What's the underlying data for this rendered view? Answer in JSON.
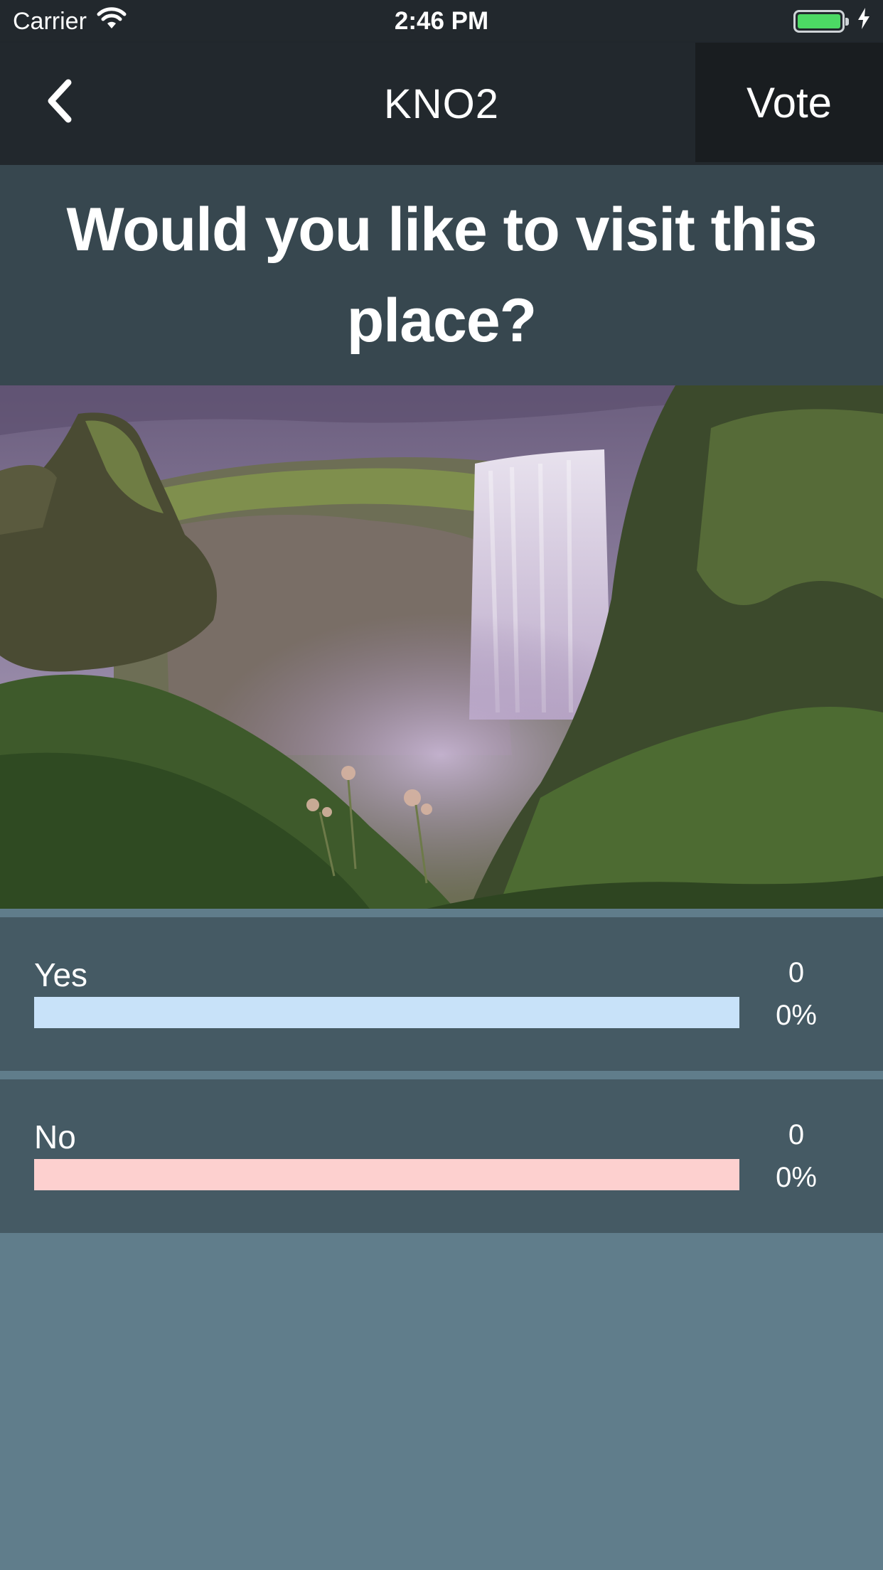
{
  "status_bar": {
    "carrier": "Carrier",
    "time": "2:46 PM",
    "wifi_icon": "wifi-icon",
    "battery_icon": "battery-icon",
    "charging_icon": "bolt-icon"
  },
  "nav": {
    "back_icon": "chevron-left-icon",
    "title": "KNO2",
    "vote_label": "Vote"
  },
  "question": {
    "text": "Would you like to visit this place?"
  },
  "options": [
    {
      "label": "Yes",
      "count": "0",
      "percent": "0%",
      "color": "#c8e2f9"
    },
    {
      "label": "No",
      "count": "0",
      "percent": "0%",
      "color": "#fdd0cf"
    }
  ],
  "colors": {
    "status_nav_bg": "#22282d",
    "vote_button_bg": "#191d20",
    "question_bg": "#37474f",
    "card_bg": "#455a64",
    "page_bg": "#607d8b",
    "battery_green": "#4cd964"
  }
}
